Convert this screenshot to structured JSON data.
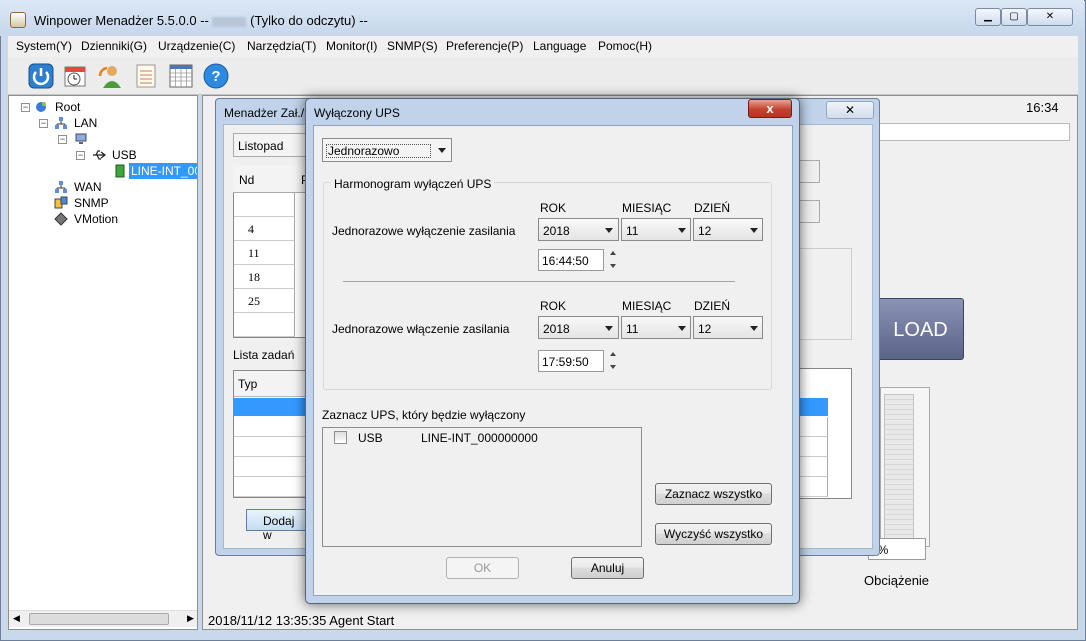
{
  "app": {
    "title": "Winpower Menadżer 5.5.0.0 --",
    "title_suffix": "(Tylko do odczytu) --",
    "window_controls": [
      "minimize",
      "maximize",
      "close"
    ]
  },
  "menubar": [
    "System(Y)",
    "Dzienniki(G)",
    "Urządzenie(C)",
    "Narzędzia(T)",
    "Monitor(I)",
    "SNMP(S)",
    "Preferencje(P)",
    "Language",
    "Pomoc(H)"
  ],
  "toolbar": {
    "icons": [
      "power-icon",
      "clock-schedule-icon",
      "user-refresh-icon",
      "list-icon",
      "calendar-grid-icon",
      "help-icon"
    ]
  },
  "tree": {
    "root": "Root",
    "lan": "LAN",
    "usb": "USB",
    "device": "LINE-INT_00",
    "wan": "WAN",
    "snmp": "SNMP",
    "vmotion": "VMotion"
  },
  "right_panel": {
    "time": "16:34",
    "load_button": "LOAD",
    "load_percent": "0%",
    "load_label": "Obciążenie",
    "status": "2018/11/12 13:35:35  Agent Start"
  },
  "bg_dialog": {
    "title": "Menadżer Zał./",
    "close": "✕",
    "month": "Listopad",
    "cal_header": "Nd",
    "cal_header_2": "P",
    "cal_days": [
      "",
      "4",
      "11",
      "18",
      "25",
      ""
    ],
    "tasks_label": "Lista zadań",
    "task_header": "Typ",
    "add_button": "Dodaj w"
  },
  "modal": {
    "title": "Wyłączony UPS",
    "close": "x",
    "mode": "Jednorazowo",
    "schedule_title": "Harmonogram wyłączeń UPS",
    "col_year": "ROK",
    "col_month": "MIESIĄC",
    "col_day": "DZIEŃ",
    "shutdown": {
      "label": "Jednorazowe wyłączenie zasilania",
      "year": "2018",
      "month": "11",
      "day": "12",
      "time": "16:44:50"
    },
    "startup": {
      "label": "Jednorazowe włączenie zasilania",
      "year": "2018",
      "month": "11",
      "day": "12",
      "time": "17:59:50"
    },
    "select_label": "Zaznacz UPS, który będzie wyłączony",
    "ups_type": "USB",
    "ups_name": "LINE-INT_000000000",
    "select_all": "Zaznacz wszystko",
    "clear_all": "Wyczyść wszystko",
    "ok": "OK",
    "cancel": "Anuluj"
  }
}
